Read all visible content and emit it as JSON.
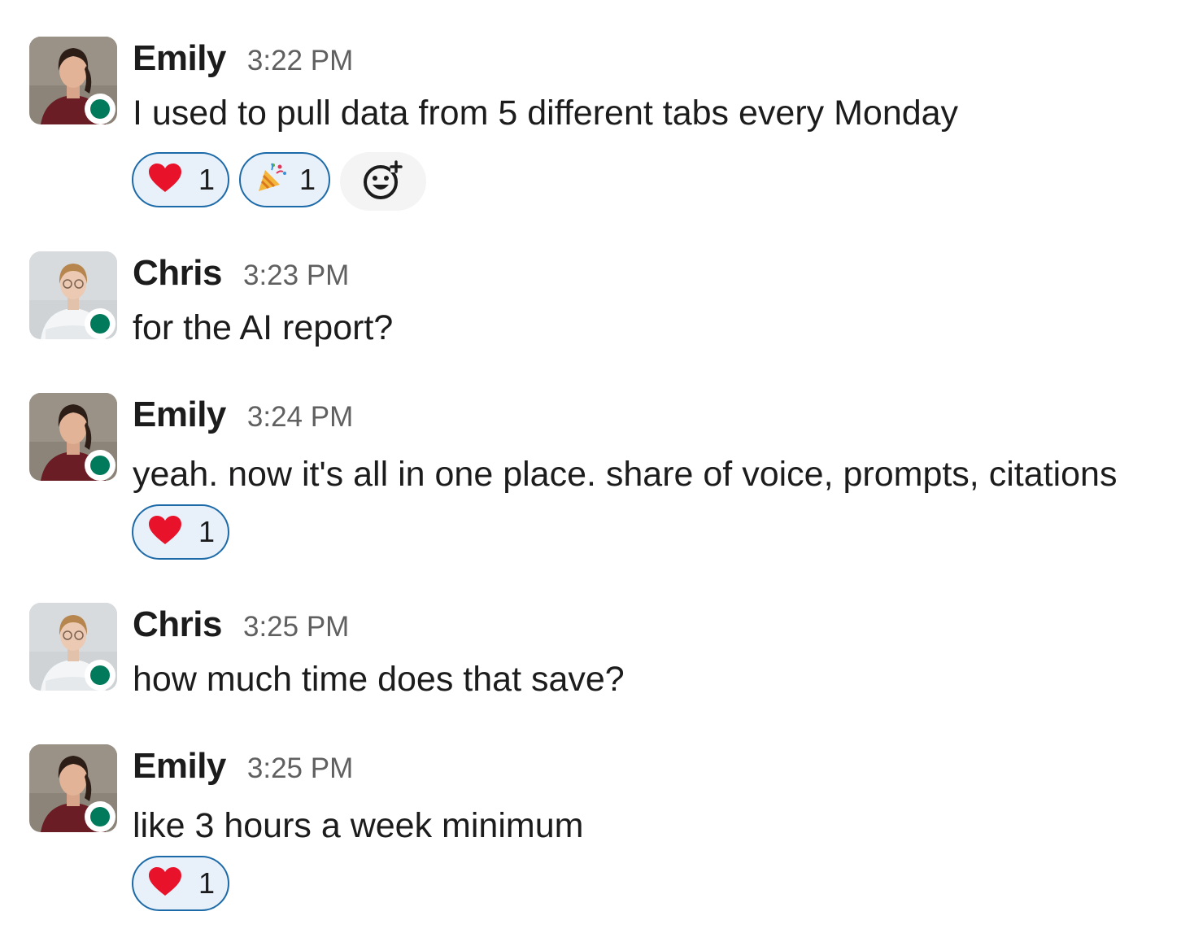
{
  "messages": [
    {
      "author": "Emily",
      "time": "3:22 PM",
      "text": "I used to pull data from 5 different tabs every Monday",
      "avatar": "emily-avatar",
      "status": "online",
      "reactions": [
        {
          "icon": "heart-icon",
          "count": "1"
        },
        {
          "icon": "party-popper-icon",
          "count": "1"
        }
      ]
    },
    {
      "author": "Chris",
      "time": "3:23 PM",
      "text": "for the AI report?",
      "avatar": "chris-avatar",
      "status": "online",
      "reactions": []
    },
    {
      "author": "Emily",
      "time": "3:24 PM",
      "text": "yeah. now it's all in one place. share of voice, prompts, citations",
      "avatar": "emily-avatar",
      "status": "online",
      "reactions": [
        {
          "icon": "heart-icon",
          "count": "1"
        }
      ]
    },
    {
      "author": "Chris",
      "time": "3:25 PM",
      "text": "how much time does that save?",
      "avatar": "chris-avatar",
      "status": "online",
      "reactions": []
    },
    {
      "author": "Emily",
      "time": "3:25 PM",
      "text": "like 3 hours a week minimum",
      "avatar": "emily-avatar",
      "status": "online",
      "reactions": [
        {
          "icon": "heart-icon",
          "count": "1"
        }
      ]
    }
  ],
  "add_reaction_icon": "add-emoji-icon",
  "colors": {
    "presence_online": "#007a5a",
    "reaction_border": "#1d6aa8",
    "reaction_bg": "#e8f1fa",
    "timestamp": "#616061",
    "text": "#1d1c1d"
  }
}
